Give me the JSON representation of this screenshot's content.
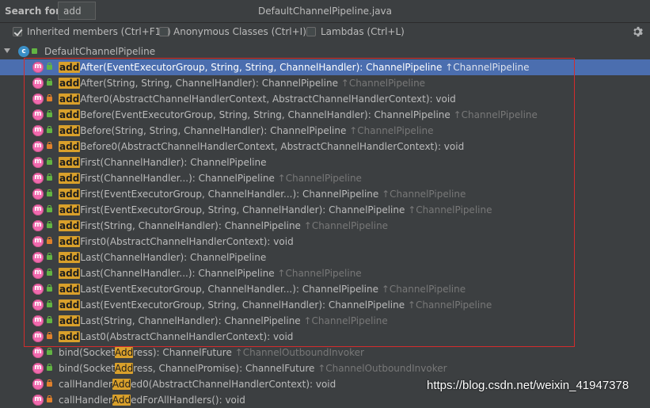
{
  "search": {
    "label": "Search for:",
    "value": "add"
  },
  "file_title": "DefaultChannelPipeline.java",
  "options": {
    "inherited": {
      "label": "Inherited members (Ctrl+F12)",
      "checked": true
    },
    "anonymous": {
      "label": "Anonymous Classes (Ctrl+I)",
      "checked": false
    },
    "lambdas": {
      "label": "Lambdas (Ctrl+L)",
      "checked": false
    }
  },
  "tree": {
    "root": "DefaultChannelPipeline",
    "items": [
      {
        "pre": "",
        "match": "add",
        "post": "After(EventExecutorGroup, String, String, ChannelHandler): ChannelPipeline",
        "inherit": "↑ChannelPipeline",
        "access": "public",
        "selected": true
      },
      {
        "pre": "",
        "match": "add",
        "post": "After(String, String, ChannelHandler): ChannelPipeline",
        "inherit": "↑ChannelPipeline",
        "access": "public"
      },
      {
        "pre": "",
        "match": "add",
        "post": "After0(AbstractChannelHandlerContext, AbstractChannelHandlerContext): void",
        "inherit": "",
        "access": "private"
      },
      {
        "pre": "",
        "match": "add",
        "post": "Before(EventExecutorGroup, String, String, ChannelHandler): ChannelPipeline",
        "inherit": "↑ChannelPipeline",
        "access": "public"
      },
      {
        "pre": "",
        "match": "add",
        "post": "Before(String, String, ChannelHandler): ChannelPipeline",
        "inherit": "↑ChannelPipeline",
        "access": "public"
      },
      {
        "pre": "",
        "match": "add",
        "post": "Before0(AbstractChannelHandlerContext, AbstractChannelHandlerContext): void",
        "inherit": "",
        "access": "private"
      },
      {
        "pre": "",
        "match": "add",
        "post": "First(ChannelHandler): ChannelPipeline",
        "inherit": "",
        "access": "public"
      },
      {
        "pre": "",
        "match": "add",
        "post": "First(ChannelHandler...): ChannelPipeline",
        "inherit": "↑ChannelPipeline",
        "access": "public"
      },
      {
        "pre": "",
        "match": "add",
        "post": "First(EventExecutorGroup, ChannelHandler...): ChannelPipeline",
        "inherit": "↑ChannelPipeline",
        "access": "public"
      },
      {
        "pre": "",
        "match": "add",
        "post": "First(EventExecutorGroup, String, ChannelHandler): ChannelPipeline",
        "inherit": "↑ChannelPipeline",
        "access": "public"
      },
      {
        "pre": "",
        "match": "add",
        "post": "First(String, ChannelHandler): ChannelPipeline",
        "inherit": "↑ChannelPipeline",
        "access": "public"
      },
      {
        "pre": "",
        "match": "add",
        "post": "First0(AbstractChannelHandlerContext): void",
        "inherit": "",
        "access": "private"
      },
      {
        "pre": "",
        "match": "add",
        "post": "Last(ChannelHandler): ChannelPipeline",
        "inherit": "",
        "access": "public"
      },
      {
        "pre": "",
        "match": "add",
        "post": "Last(ChannelHandler...): ChannelPipeline",
        "inherit": "↑ChannelPipeline",
        "access": "public"
      },
      {
        "pre": "",
        "match": "add",
        "post": "Last(EventExecutorGroup, ChannelHandler...): ChannelPipeline",
        "inherit": "↑ChannelPipeline",
        "access": "public"
      },
      {
        "pre": "",
        "match": "add",
        "post": "Last(EventExecutorGroup, String, ChannelHandler): ChannelPipeline",
        "inherit": "↑ChannelPipeline",
        "access": "public"
      },
      {
        "pre": "",
        "match": "add",
        "post": "Last(String, ChannelHandler): ChannelPipeline",
        "inherit": "↑ChannelPipeline",
        "access": "public"
      },
      {
        "pre": "",
        "match": "add",
        "post": "Last0(AbstractChannelHandlerContext): void",
        "inherit": "",
        "access": "private"
      },
      {
        "pre": "bind(Socket",
        "match": "Add",
        "post": "ress): ChannelFuture",
        "inherit": "↑ChannelOutboundInvoker",
        "access": "public"
      },
      {
        "pre": "bind(Socket",
        "match": "Add",
        "post": "ress, ChannelPromise): ChannelFuture",
        "inherit": "↑ChannelOutboundInvoker",
        "access": "public"
      },
      {
        "pre": "callHandler",
        "match": "Add",
        "post": "ed0(AbstractChannelHandlerContext): void",
        "inherit": "",
        "access": "private"
      },
      {
        "pre": "callHandler",
        "match": "Add",
        "post": "edForAllHandlers(): void",
        "inherit": "",
        "access": "private"
      }
    ]
  },
  "watermark": "https://blog.csdn.net/weixin_41947378",
  "colors": {
    "selection": "#4b6eaf",
    "highlight": "#d9a02b",
    "annotation_box": "#d42c2c",
    "method_icon": "#f26aaf"
  }
}
